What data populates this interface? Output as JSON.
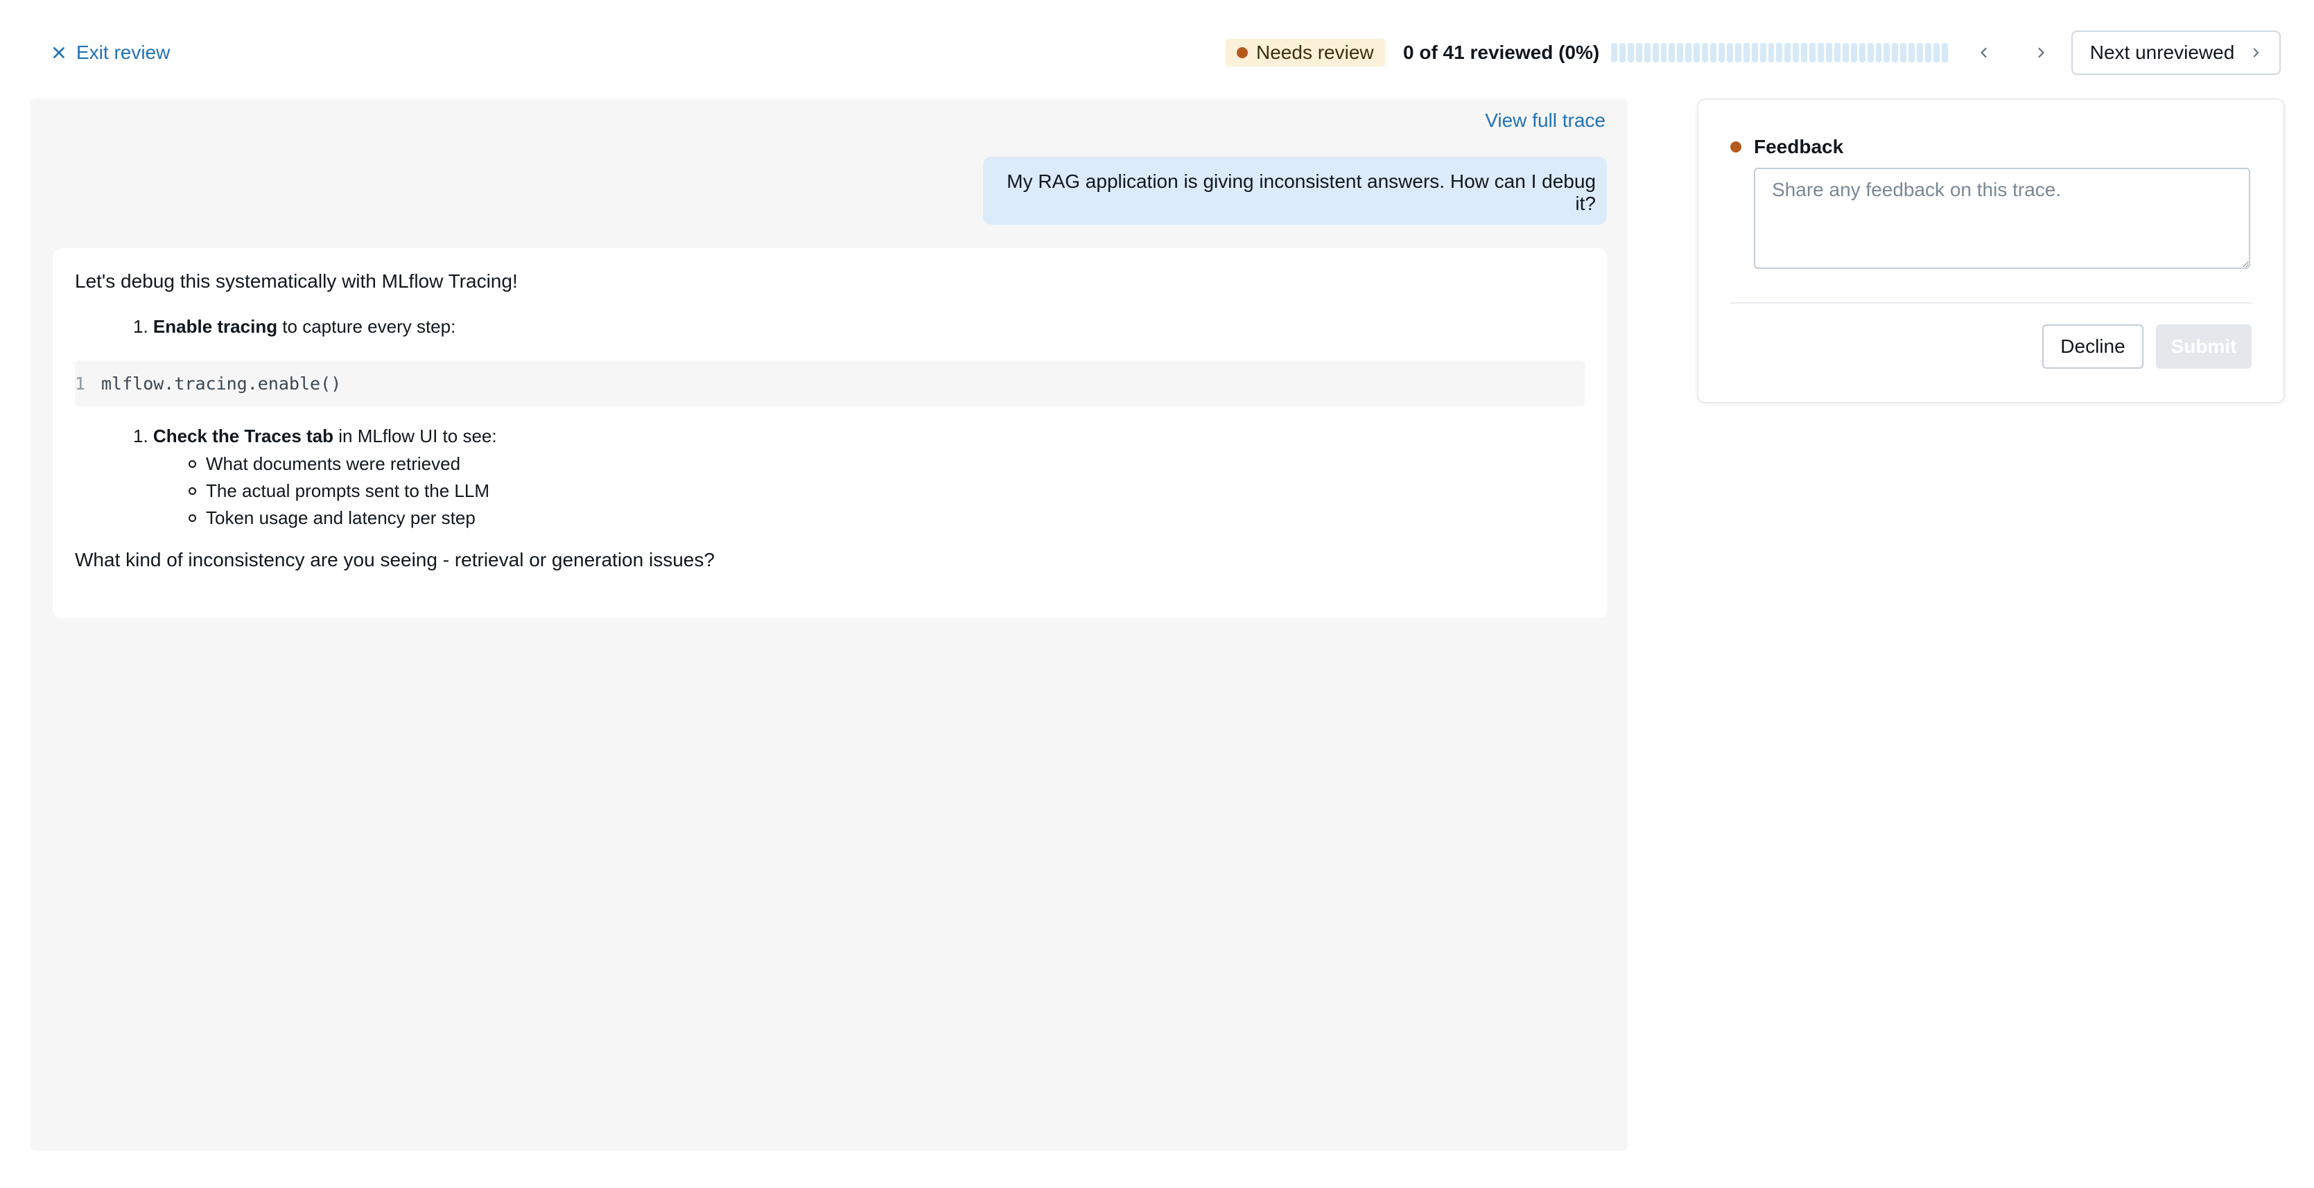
{
  "header": {
    "exit_label": "Exit review",
    "status_badge": "Needs review",
    "progress_text": "0 of 41 reviewed (0%)",
    "progress": {
      "reviewed": 0,
      "total": 41
    },
    "next_unreviewed_label": "Next unreviewed"
  },
  "trace": {
    "view_full_label": "View full trace",
    "user_message": "My RAG application is giving inconsistent answers. How can I debug it?",
    "assistant": {
      "intro": "Let's debug this systematically with MLflow Tracing!",
      "step1_number": "1.",
      "step1_bold": "Enable tracing",
      "step1_rest": " to capture every step:",
      "code_line_number": "1",
      "code": "mlflow.tracing.enable()",
      "step2_number": "1.",
      "step2_bold": "Check the Traces tab",
      "step2_rest": " in MLflow UI to see:",
      "sub_items": [
        "What documents were retrieved",
        "The actual prompts sent to the LLM",
        "Token usage and latency per step"
      ],
      "question": "What kind of inconsistency are you seeing - retrieval or generation issues?"
    }
  },
  "feedback": {
    "title": "Feedback",
    "placeholder": "Share any feedback on this trace.",
    "value": "",
    "decline_label": "Decline",
    "submit_label": "Submit"
  },
  "colors": {
    "accent": "#2272b4",
    "status_dot": "#b45a1e",
    "badge_bg": "#fbf0d8",
    "user_bubble": "#dcebfa",
    "panel_bg": "#f6f6f6"
  }
}
